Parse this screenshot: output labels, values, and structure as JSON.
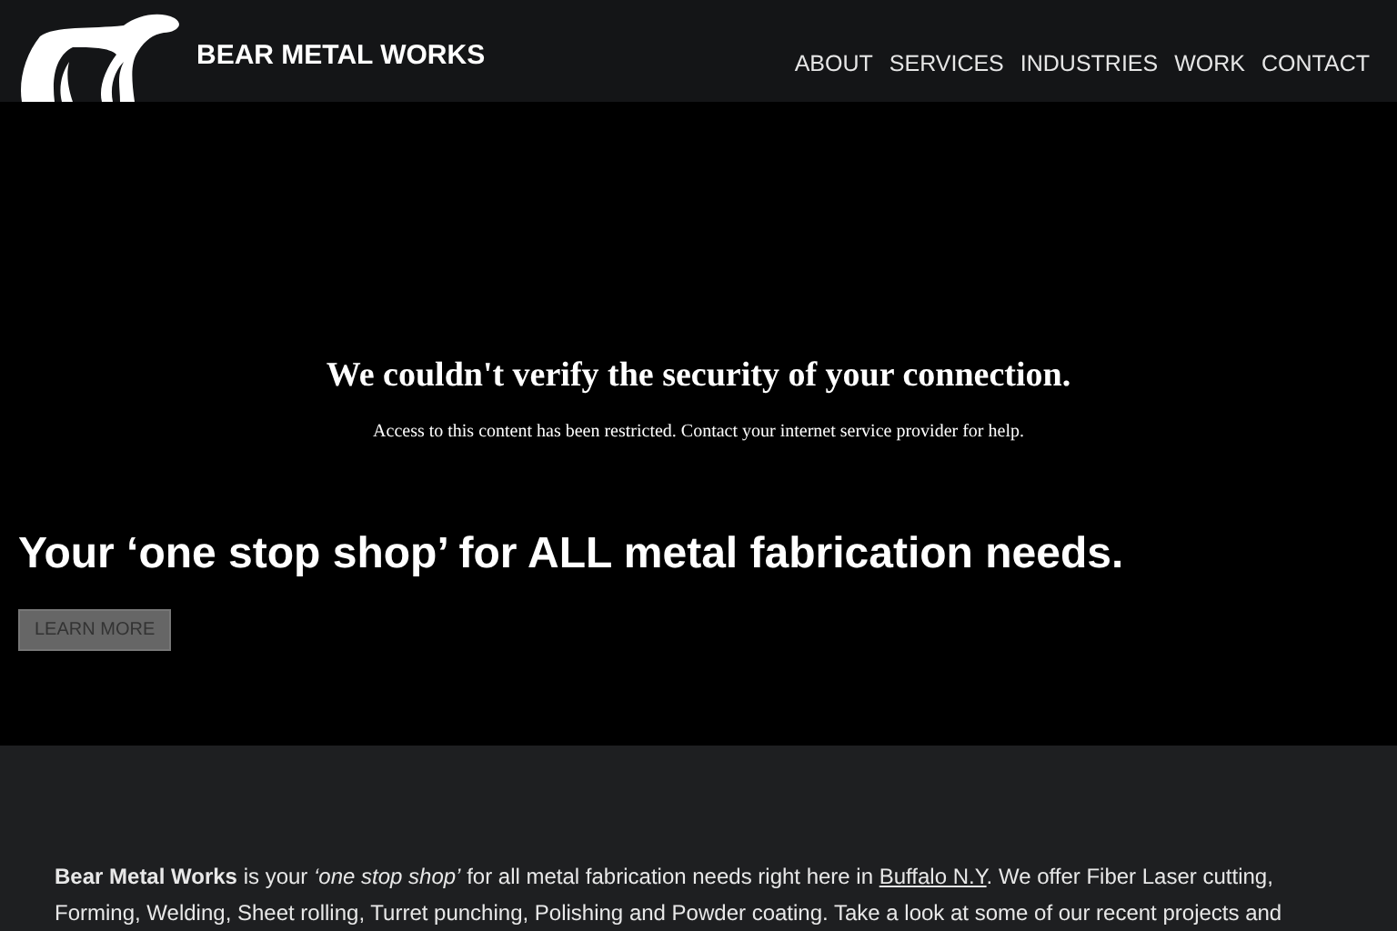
{
  "header": {
    "brand": "BEAR METAL WORKS",
    "nav": [
      {
        "label": "ABOUT"
      },
      {
        "label": "SERVICES"
      },
      {
        "label": "INDUSTRIES"
      },
      {
        "label": "WORK"
      },
      {
        "label": "CONTACT"
      }
    ]
  },
  "hero": {
    "error_title": "We couldn't verify the security of your connection.",
    "error_message": "Access to this content has been restricted. Contact your internet service provider for help.",
    "headline": "Your ‘one stop shop’ for ALL metal fabrication needs.",
    "button": "LEARN MORE"
  },
  "intro": {
    "before_link": "**Bear Metal Works** is your *‘one stop shop’* for all metal fabrication needs right here in ",
    "link": "Buffalo N.Y",
    "after_link": ". We offer Fiber Laser cutting, Forming, Welding,  Sheet rolling, Turret punching, Polishing and Powder coating. Take a look at some of our recent projects and"
  }
}
